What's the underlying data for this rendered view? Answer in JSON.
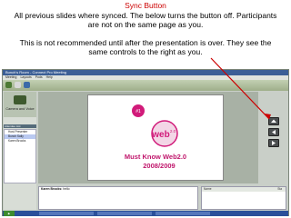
{
  "caption": {
    "title": "Sync Button",
    "line1": "All previous slides where synced.  The below turns the button off.  Participants",
    "line2": "are not on the same page as you.",
    "line3": "This is not recommended until after the presentation is over.  They see the",
    "line4": "same controls to the right as you."
  },
  "window": {
    "title": "Bunch's Room - Connect Pro Meeting",
    "menu": [
      "Meeting",
      "Layouts",
      "Pods",
      "Help"
    ]
  },
  "left": {
    "camera_label": "Camera and Voice",
    "attendees_header": "Attendee List",
    "users": [
      "Host Presenter",
      "Bunch Sally",
      "Karen Brooks"
    ]
  },
  "slide": {
    "heading_line1": "Must Know Web2.0",
    "heading_line2": "2008/2009",
    "logo_text": "web",
    "logo_sup": "2.0",
    "bubble_text": "#1"
  },
  "chat": {
    "line1_name": "Karen Brooks:",
    "line1_text": "hello"
  },
  "notes": {
    "col1": "Name",
    "col2": "Sta"
  },
  "colors": {
    "caption_title": "#cc0000",
    "logo_pink": "#d11b7a",
    "slide_heading": "#c0176c",
    "taskbar": "#2a4f9a"
  }
}
